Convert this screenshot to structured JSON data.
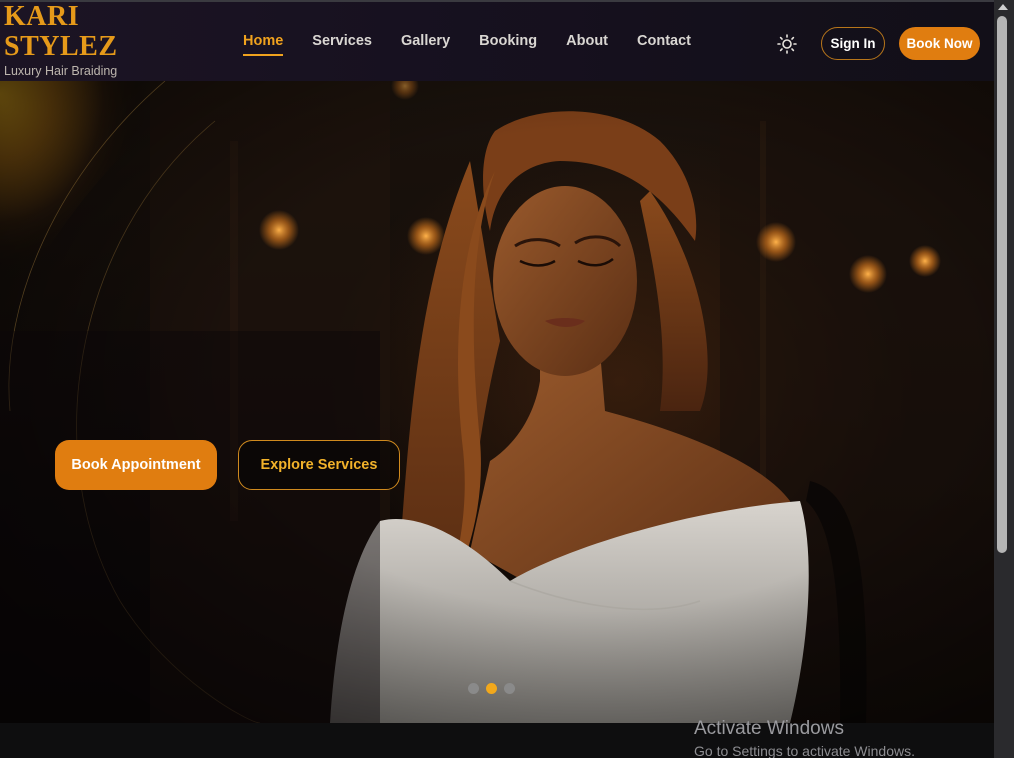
{
  "brand": {
    "name": "KARI STYLEZ",
    "tagline": "Luxury Hair Braiding"
  },
  "nav": {
    "items": [
      {
        "label": "Home",
        "active": true
      },
      {
        "label": "Services",
        "active": false
      },
      {
        "label": "Gallery",
        "active": false
      },
      {
        "label": "Booking",
        "active": false
      },
      {
        "label": "About",
        "active": false
      },
      {
        "label": "Contact",
        "active": false
      }
    ],
    "theme_icon": "sun-icon"
  },
  "header": {
    "sign_in_label": "Sign In",
    "book_now_label": "Book Now"
  },
  "hero": {
    "primary_cta": "Book Appointment",
    "secondary_cta": "Explore Services",
    "slides": {
      "count": 3,
      "active_index": 1
    }
  },
  "watermark": {
    "title": "Activate Windows",
    "subtitle": "Go to Settings to activate Windows."
  },
  "colors": {
    "accent": "#e07d10",
    "accent_text": "#f0a21e",
    "brand": "#e69a1a",
    "header_bg": "#171120",
    "hero_bg": "#120c09"
  }
}
